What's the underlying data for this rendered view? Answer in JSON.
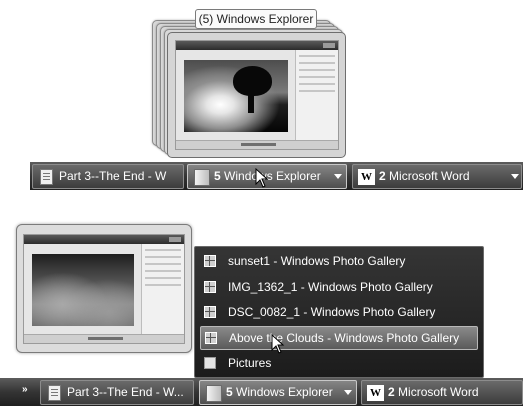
{
  "top_preview": {
    "title": "(5) Windows Explorer"
  },
  "taskbar_top": {
    "doc_label": "Part 3--The End - W",
    "explorer_count": "5",
    "explorer_label": "Windows Explorer",
    "word_count": "2",
    "word_label": "Microsoft Word"
  },
  "jump_list": {
    "items": [
      {
        "label": "sunset1 - Windows Photo Gallery",
        "icon": "photo-gallery-icon"
      },
      {
        "label": "IMG_1362_1 - Windows Photo Gallery",
        "icon": "photo-gallery-icon"
      },
      {
        "label": "DSC_0082_1 - Windows Photo Gallery",
        "icon": "photo-gallery-icon"
      },
      {
        "label": "Above the Clouds - Windows Photo Gallery",
        "icon": "photo-gallery-icon",
        "highlighted": true
      },
      {
        "label": "Pictures",
        "icon": "folder-icon"
      }
    ]
  },
  "taskbar_bottom": {
    "overflow": "»",
    "doc_label": "Part 3--The End - W...",
    "explorer_count": "5",
    "explorer_label": "Windows Explorer",
    "word_count": "2",
    "word_label": "Microsoft Word"
  },
  "icons": {
    "word": "W"
  },
  "colors": {
    "taskbar": "#343434",
    "jump_list_bg": "#262626",
    "highlight": "#6e6e6e"
  }
}
